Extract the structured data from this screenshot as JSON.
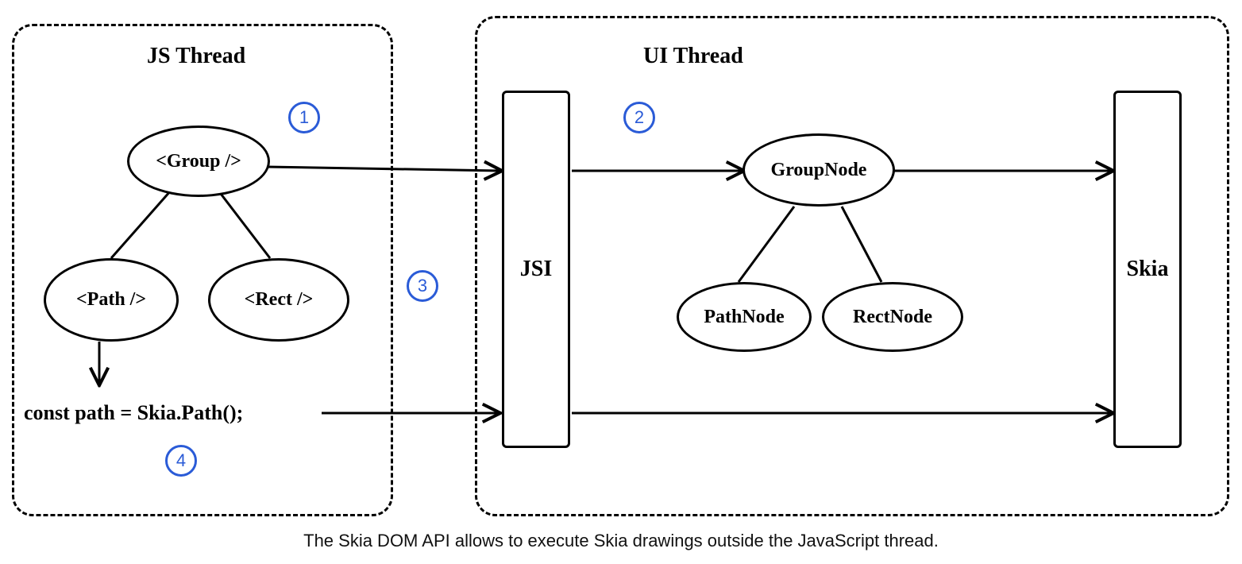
{
  "js_thread": {
    "title": "JS Thread",
    "nodes": {
      "group": "<Group />",
      "path": "<Path />",
      "rect": "<Rect />"
    },
    "code_line": "const path = Skia.Path();"
  },
  "ui_thread": {
    "title": "UI Thread",
    "nodes": {
      "group": "GroupNode",
      "path": "PathNode",
      "rect": "RectNode"
    }
  },
  "bridge_label": "JSI",
  "skia_label": "Skia",
  "badges": {
    "one": "1",
    "two": "2",
    "three": "3",
    "four": "4"
  },
  "caption": "The Skia DOM API allows to execute Skia drawings outside the JavaScript thread.",
  "colors": {
    "accent": "#2a5bd7"
  }
}
